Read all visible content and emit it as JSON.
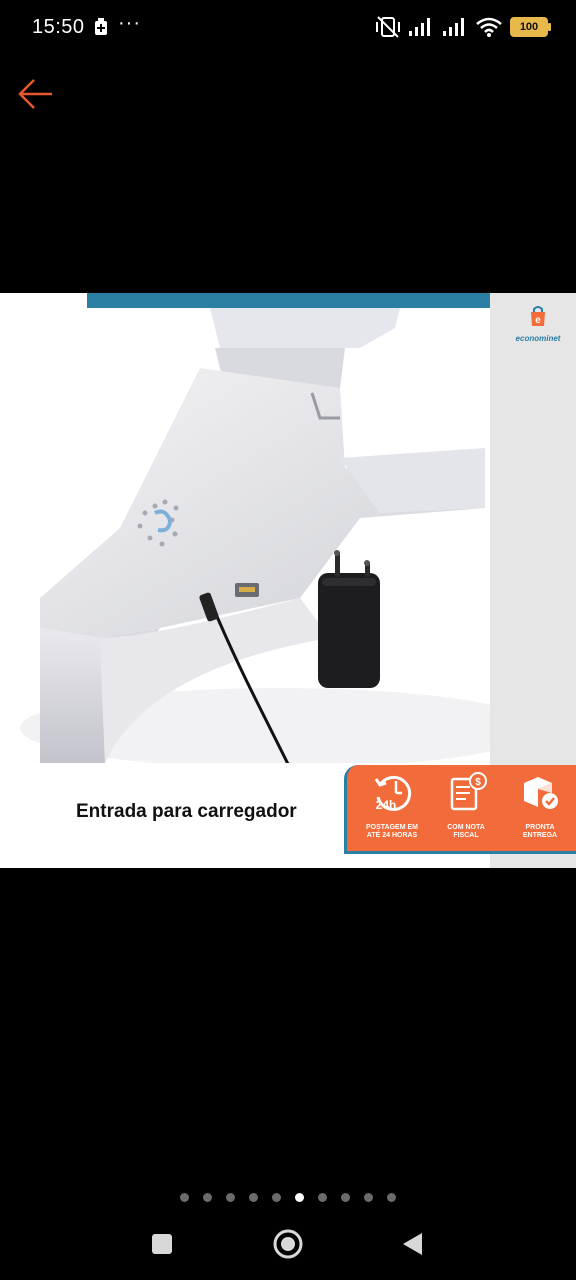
{
  "status_bar": {
    "time": "15:50",
    "more": "···",
    "battery_level": "100",
    "icons": [
      "battery-saver-icon",
      "vibrate-off-icon",
      "signal-icon",
      "signal-icon",
      "wifi-icon",
      "battery-icon"
    ]
  },
  "toolbar": {
    "back_icon": "arrow-left-icon",
    "back_color": "#e8582e"
  },
  "product_image": {
    "caption": "Entrada para carregador",
    "brand": "econominet",
    "badges": [
      {
        "icon": "clock-24h-icon",
        "big": "24h",
        "label_line1": "POSTAGEM EM",
        "label_line2": "ATÉ 24 HORAS"
      },
      {
        "icon": "invoice-icon",
        "label_line1": "COM NOTA",
        "label_line2": "FISCAL"
      },
      {
        "icon": "box-check-icon",
        "label_line1": "PRONTA",
        "label_line2": "ENTREGA"
      }
    ],
    "accent_color": "#f26b3a",
    "brand_color": "#2a7fa3"
  },
  "gallery": {
    "page_count": 10,
    "current_page": 6
  },
  "nav_bar": {
    "buttons": [
      "recents-button",
      "home-button",
      "back-button"
    ]
  }
}
